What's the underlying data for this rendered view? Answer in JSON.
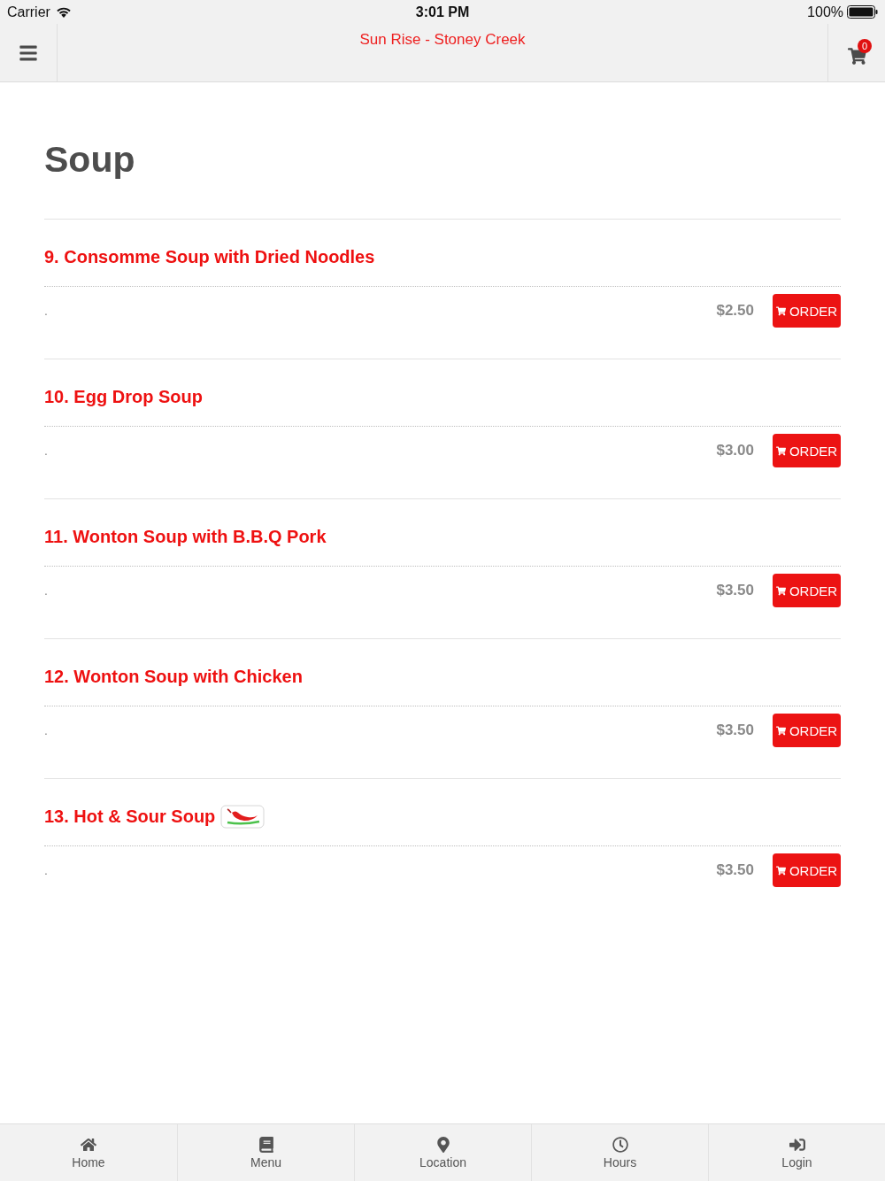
{
  "status_bar": {
    "carrier": "Carrier",
    "time": "3:01 PM",
    "battery": "100%"
  },
  "nav_bar": {
    "title": "Sun Rise - Stoney Creek",
    "cart_count": "0"
  },
  "section": {
    "title": "Soup"
  },
  "items": [
    {
      "name": "9. Consomme Soup with Dried Noodles",
      "spicy": false,
      "description": ".",
      "price": "$2.50",
      "button": "ORDER"
    },
    {
      "name": "10. Egg Drop Soup",
      "spicy": false,
      "description": ".",
      "price": "$3.00",
      "button": "ORDER"
    },
    {
      "name": "11. Wonton Soup with B.B.Q Pork",
      "spicy": false,
      "description": ".",
      "price": "$3.50",
      "button": "ORDER"
    },
    {
      "name": "12. Wonton Soup with Chicken",
      "spicy": false,
      "description": ".",
      "price": "$3.50",
      "button": "ORDER"
    },
    {
      "name": "13. Hot & Sour Soup",
      "spicy": true,
      "description": ".",
      "price": "$3.50",
      "button": "ORDER"
    }
  ],
  "tab_bar": [
    {
      "label": "Home"
    },
    {
      "label": "Menu"
    },
    {
      "label": "Location"
    },
    {
      "label": "Hours"
    },
    {
      "label": "Login"
    }
  ]
}
